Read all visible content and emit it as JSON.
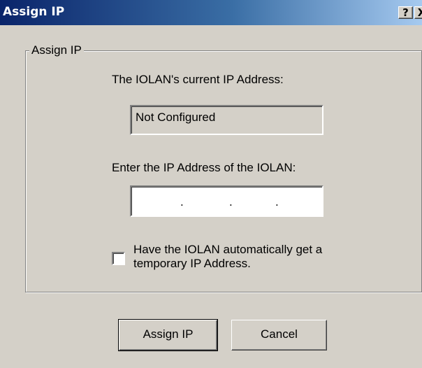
{
  "window": {
    "title": "Assign IP",
    "help_glyph": "?",
    "close_glyph": "X"
  },
  "group": {
    "legend": "Assign IP",
    "current_ip_label": "The IOLAN's current IP Address:",
    "current_ip_value": "Not Configured",
    "enter_ip_label": "Enter the IP Address of the IOLAN:",
    "ip_input": {
      "value": "",
      "separator": "."
    },
    "auto_ip_checkbox": {
      "checked": false,
      "label_line1": "Have the IOLAN automatically get a",
      "label_line2": "temporary IP Address."
    }
  },
  "buttons": {
    "assign": "Assign IP",
    "cancel": "Cancel"
  }
}
